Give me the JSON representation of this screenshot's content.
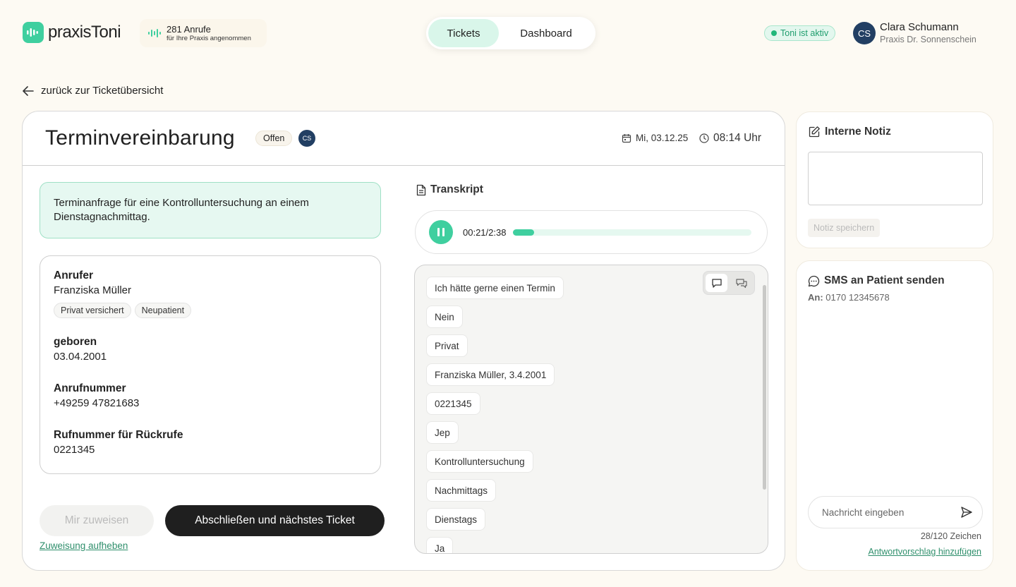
{
  "brand": {
    "name": "praxisToni"
  },
  "calls": {
    "count_label": "281 Anrufe",
    "sub_label": "für Ihre Praxis angenommen"
  },
  "nav": {
    "tabs": [
      {
        "label": "Tickets",
        "active": true
      },
      {
        "label": "Dashboard",
        "active": false
      }
    ]
  },
  "status": {
    "label": "Toni ist aktiv",
    "color": "#22b77b"
  },
  "user": {
    "initials": "CS",
    "name": "Clara Schumann",
    "org": "Praxis Dr. Sonnenschein"
  },
  "back_link": "zurück zur Ticketübersicht",
  "ticket": {
    "title": "Terminvereinbarung",
    "status": "Offen",
    "assignee_initials": "CS",
    "date": "Mi, 03.12.25",
    "time": "08:14 Uhr",
    "summary": "Terminanfrage für eine Kontrolluntersuchung an einem Dienstagnachmittag.",
    "caller": {
      "label": "Anrufer",
      "name": "Franziska Müller",
      "tags": [
        "Privat versichert",
        "Neupatient"
      ]
    },
    "born": {
      "label": "geboren",
      "value": "03.04.2001"
    },
    "phone": {
      "label": "Anrufnummer",
      "value": "+49259 47821683"
    },
    "callback": {
      "label": "Rufnummer für Rückrufe",
      "value": "0221345"
    }
  },
  "actions": {
    "assign": "Mir zuweisen",
    "complete": "Abschließen und nächstes Ticket",
    "unassign": "Zuweisung aufheben"
  },
  "transcript": {
    "title": "Transkript",
    "player": {
      "time": "00:21/2:38",
      "progress": 0.088
    },
    "messages": [
      "Ich hätte gerne einen Termin",
      "Nein",
      "Privat",
      "Franziska Müller, 3.4.2001",
      "0221345",
      "Jep",
      "Kontrolluntersuchung",
      "Nachmittags",
      "Dienstags",
      "Ja"
    ]
  },
  "note": {
    "title": "Interne Notiz",
    "value": "",
    "save_label": "Notiz speichern"
  },
  "sms": {
    "title": "SMS an Patient senden",
    "to_label": "An:",
    "to_number": "0170 12345678",
    "placeholder": "Nachricht eingeben",
    "char_count": "28/120 Zeichen",
    "suggest_label": "Antwortvorschlag hinzufügen"
  },
  "colors": {
    "accent": "#3fcf9f",
    "dark": "#1f1f1f",
    "avatar": "#223f63"
  },
  "icons": [
    "logo-icon",
    "waveform-icon",
    "arrow-left-icon",
    "calendar-icon",
    "clock-icon",
    "document-icon",
    "pause-icon",
    "chat-bubble-icon",
    "chat-double-icon",
    "edit-icon",
    "message-icon",
    "send-icon"
  ]
}
